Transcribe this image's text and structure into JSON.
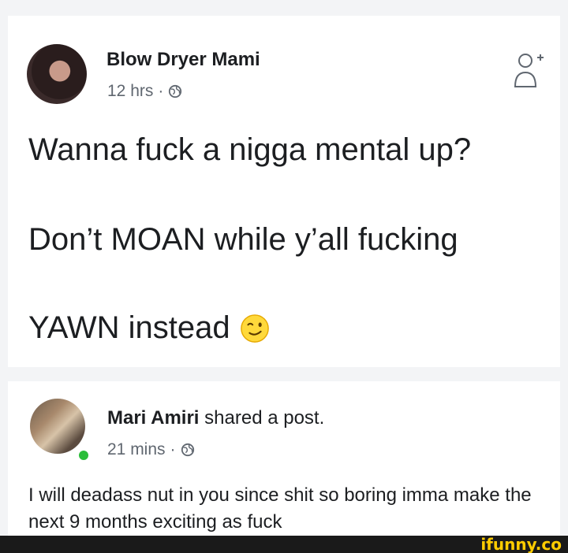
{
  "post1": {
    "author": "Blow Dryer Mami",
    "time": "12 hrs",
    "separator": "·",
    "lines": [
      "Wanna fuck a nigga mental up?",
      "Don’t MOAN while y’all fucking",
      "YAWN instead"
    ],
    "emoji": "winking-face-emoji"
  },
  "post2": {
    "author": "Mari Amiri",
    "action": "shared a post.",
    "time": "21 mins",
    "separator": "·",
    "text": "I will deadass nut in you since shit so boring imma make the next 9 months exciting as fuck"
  },
  "watermark": "ifunny.co",
  "colors": {
    "background": "#f3f4f6",
    "text": "#1c1e21",
    "meta": "#606770",
    "online": "#2bbd3a",
    "watermark": "#ffcc00"
  }
}
